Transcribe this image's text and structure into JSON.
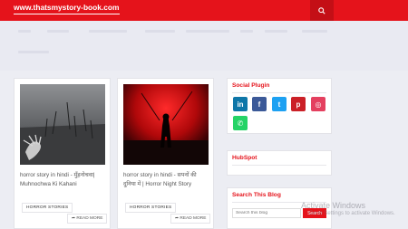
{
  "header": {
    "logo_text": "www.thatsmystory-book.com"
  },
  "posts": [
    {
      "title_line1": "horror story in hindi - मुँहनोचवा|",
      "title_line2": "Muhnochwa Ki Kahani",
      "tag": "HORROR STORIES",
      "read_more": "READ MORE"
    },
    {
      "title_line1": "horror story in hindi - सपनों की",
      "title_line2": "दुनिया में | Horror Night Story",
      "tag": "HORROR STORIES",
      "read_more": "READ MORE"
    }
  ],
  "sidebar": {
    "social_title": "Social Plugin",
    "hubspot_title": "HubSpot",
    "search_title": "Search This Blog",
    "search_placeholder": "Search this blog",
    "search_button": "Search"
  },
  "social_icons": [
    {
      "name": "linkedin",
      "glyph": "in",
      "color": "#0e76a8"
    },
    {
      "name": "facebook",
      "glyph": "f",
      "color": "#3b5998"
    },
    {
      "name": "twitter",
      "glyph": "t",
      "color": "#1da1f2"
    },
    {
      "name": "pinterest",
      "glyph": "p",
      "color": "#cb2027"
    },
    {
      "name": "instagram",
      "glyph": "◎",
      "color": "#e4405f"
    },
    {
      "name": "whatsapp",
      "glyph": "✆",
      "color": "#25d366"
    }
  ],
  "os_overlay": {
    "line1": "Activate Windows",
    "line2": "Go to Settings to activate Windows."
  },
  "colors": {
    "brand_red": "#e5131b"
  }
}
